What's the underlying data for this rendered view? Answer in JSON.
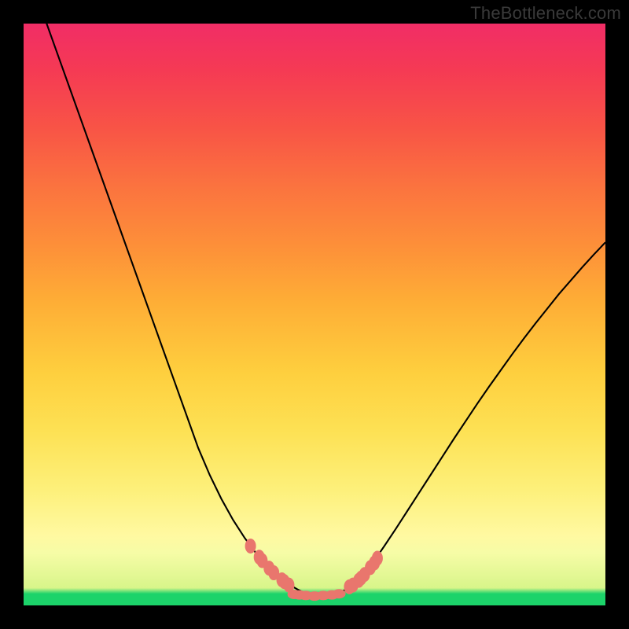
{
  "watermark": "TheBottleneck.com",
  "colors": {
    "frame_bg": "#000000",
    "curve_stroke": "#000000",
    "marker_fill": "#e9766d",
    "marker_stroke": "#e9766d"
  },
  "chart_data": {
    "type": "line",
    "title": "",
    "xlabel": "",
    "ylabel": "",
    "xlim": [
      0,
      1
    ],
    "ylim": [
      0,
      1
    ],
    "grid": false,
    "series": [
      {
        "name": "bottleneck-curve",
        "x": [
          0.0,
          0.02,
          0.04,
          0.06,
          0.08,
          0.1,
          0.12,
          0.14,
          0.16,
          0.18,
          0.2,
          0.22,
          0.24,
          0.26,
          0.28,
          0.3,
          0.32,
          0.34,
          0.36,
          0.38,
          0.4,
          0.42,
          0.44,
          0.458,
          0.47,
          0.48,
          0.5,
          0.52,
          0.535,
          0.545,
          0.558,
          0.57,
          0.58,
          0.6,
          0.62,
          0.64,
          0.66,
          0.68,
          0.7,
          0.72,
          0.74,
          0.76,
          0.78,
          0.8,
          0.82,
          0.84,
          0.86,
          0.88,
          0.9,
          0.92,
          0.94,
          0.96,
          0.98,
          1.0
        ],
        "y": [
          1.11,
          1.055,
          0.999,
          0.943,
          0.887,
          0.831,
          0.775,
          0.719,
          0.663,
          0.607,
          0.551,
          0.495,
          0.439,
          0.383,
          0.327,
          0.271,
          0.224,
          0.183,
          0.147,
          0.116,
          0.089,
          0.066,
          0.048,
          0.035,
          0.028,
          0.023,
          0.017,
          0.017,
          0.019,
          0.023,
          0.029,
          0.038,
          0.048,
          0.073,
          0.102,
          0.132,
          0.163,
          0.194,
          0.225,
          0.256,
          0.287,
          0.317,
          0.347,
          0.376,
          0.404,
          0.432,
          0.459,
          0.485,
          0.51,
          0.535,
          0.558,
          0.581,
          0.603,
          0.624
        ]
      }
    ],
    "markers_left": {
      "name": "left-cluster",
      "x": [
        0.39,
        0.405,
        0.41,
        0.422,
        0.43,
        0.444,
        0.448,
        0.456
      ],
      "y": [
        0.102,
        0.083,
        0.077,
        0.064,
        0.056,
        0.044,
        0.041,
        0.035
      ]
    },
    "markers_right": {
      "name": "right-cluster",
      "x": [
        0.56,
        0.566,
        0.576,
        0.58,
        0.586,
        0.596,
        0.603,
        0.608
      ],
      "y": [
        0.032,
        0.035,
        0.043,
        0.047,
        0.053,
        0.065,
        0.073,
        0.081
      ]
    },
    "markers_bottom": {
      "name": "bottom-flat",
      "x": [
        0.465,
        0.474,
        0.485,
        0.5,
        0.515,
        0.53,
        0.542
      ],
      "y": [
        0.019,
        0.018,
        0.017,
        0.016,
        0.017,
        0.018,
        0.02
      ]
    }
  }
}
